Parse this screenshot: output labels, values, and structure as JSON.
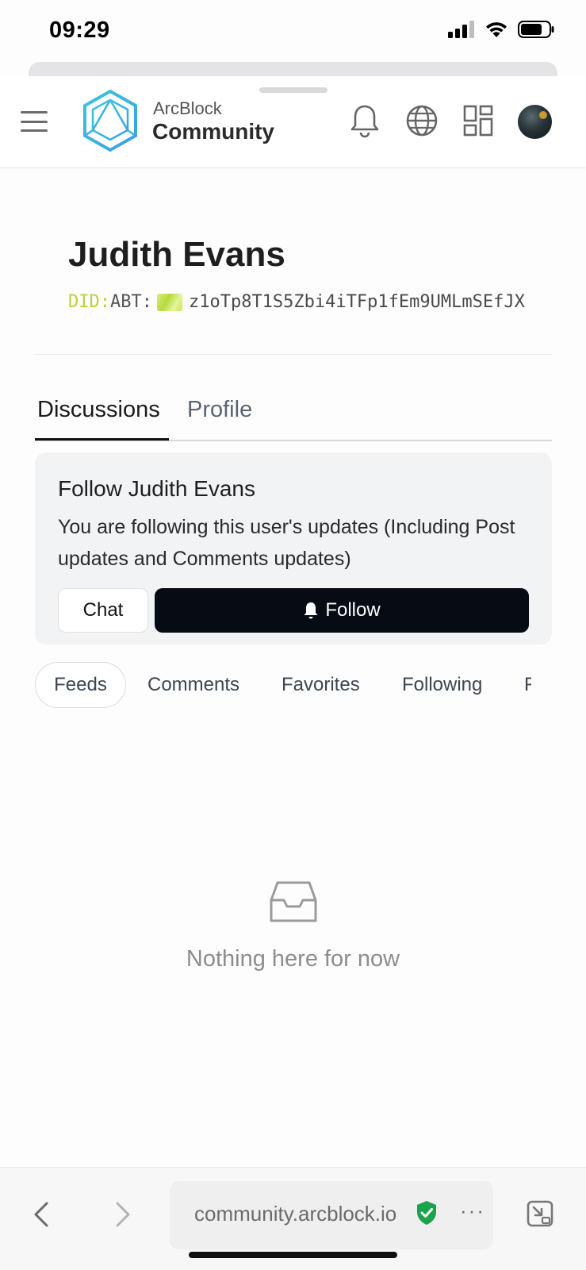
{
  "status_bar": {
    "time": "09:29"
  },
  "header": {
    "logo_top": "ArcBlock",
    "logo_bottom": "Community"
  },
  "profile": {
    "name": "Judith Evans",
    "did_prefix": "DID:",
    "did_abt": "ABT:",
    "did_value": "z1oTp8T1S5Zbi4iTFp1fEm9UMLmSEfJX"
  },
  "tabs": [
    {
      "label": "Discussions",
      "active": true
    },
    {
      "label": "Profile",
      "active": false
    }
  ],
  "follow_card": {
    "title": "Follow Judith Evans",
    "description": "You are following this user's updates (Including Post updates and Comments updates)",
    "chat_label": "Chat",
    "follow_label": "Follow"
  },
  "subtabs": [
    {
      "label": "Feeds",
      "active": true
    },
    {
      "label": "Comments",
      "active": false
    },
    {
      "label": "Favorites",
      "active": false
    },
    {
      "label": "Following",
      "active": false
    },
    {
      "label": "F",
      "active": false
    }
  ],
  "empty_state": {
    "message": "Nothing here for now"
  },
  "browser": {
    "url": "community.arcblock.io",
    "more": "···"
  },
  "colors": {
    "did_prefix": "#b9d338",
    "follow_button": "#070b14",
    "shield": "#1aa34a"
  }
}
